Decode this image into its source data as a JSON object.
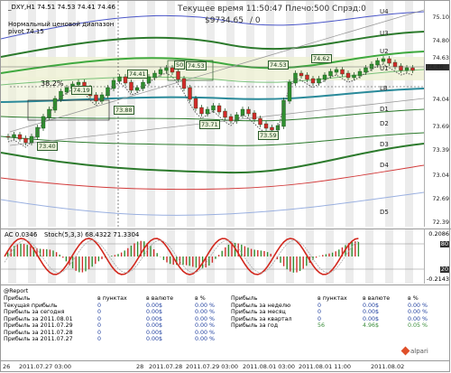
{
  "header": {
    "symbol_line": "_DXY,H1  74.51 74.53 74.41 74.46",
    "range_note": "Нормальный ценовой диапазон",
    "pivot_line": "pivot 74.15",
    "time_line": "Текущее время 11:50:47 Плечо:500 Спрэд:0",
    "balance": "$9734.65",
    "balance_suffix": "/ 0"
  },
  "range_label": "38.2%",
  "levels": [
    "U4",
    "U3",
    "U2",
    "U1",
    "LB",
    "D1",
    "D2",
    "D3",
    "D4",
    "D5"
  ],
  "price_tags": [
    "74.41",
    "74.19",
    "73.88",
    "73.71",
    "73.59",
    "73.40",
    "50",
    "74.53",
    "74.53",
    "74.62"
  ],
  "price_axis": [
    "75.10",
    "74.80",
    "74.63",
    "74.46",
    "74.04",
    "73.69",
    "73.39",
    "73.04",
    "72.69",
    "72.39"
  ],
  "current_price": "74.46",
  "indicator": {
    "ac_label": "AC 0.0346",
    "stoch_label": "Stoch(5,3,3) 68.4322 71.3304",
    "axis": [
      "0.2086",
      "80",
      "20",
      "-0.2143"
    ]
  },
  "report": {
    "title": "@Report",
    "left_headers": [
      "Прибыль",
      "в пунктах",
      "в валюте",
      "в %"
    ],
    "left_rows": [
      [
        "Текущая прибыль",
        "0",
        "0.00$",
        "0.00 %"
      ],
      [
        "Прибыль за сегодня",
        "0",
        "0.00$",
        "0.00 %"
      ],
      [
        "Прибыль за 2011.08.01",
        "0",
        "0.00$",
        "0.00 %"
      ],
      [
        "Прибыль за 2011.07.29",
        "0",
        "0.00$",
        "0.00 %"
      ],
      [
        "Прибыль за 2011.07.28",
        "0",
        "0.00$",
        "0.00 %"
      ],
      [
        "Прибыль за 2011.07.27",
        "0",
        "0.00$",
        "0.00 %"
      ]
    ],
    "right_headers": [
      "Прибыль",
      "в пунктах",
      "в валюте",
      "в %"
    ],
    "right_rows": [
      [
        "Прибыль за неделю",
        "0",
        "0.00$",
        "0.00 %"
      ],
      [
        "Прибыль за месяц",
        "0",
        "0.00$",
        "0.00 %"
      ],
      [
        "Прибыль за квартал",
        "0",
        "0.00$",
        "0.00 %"
      ],
      [
        "Прибыль за год",
        "56",
        "4.96$",
        "0.05 %"
      ]
    ]
  },
  "time_axis": [
    "26",
    "2011.07.27 03:00",
    "28",
    "2011.07.28",
    "2011.07.29 03:00",
    "2011.08.01 03:00",
    "2011.08.01 11:00",
    "2011.08.02"
  ],
  "logo": "alpari"
}
